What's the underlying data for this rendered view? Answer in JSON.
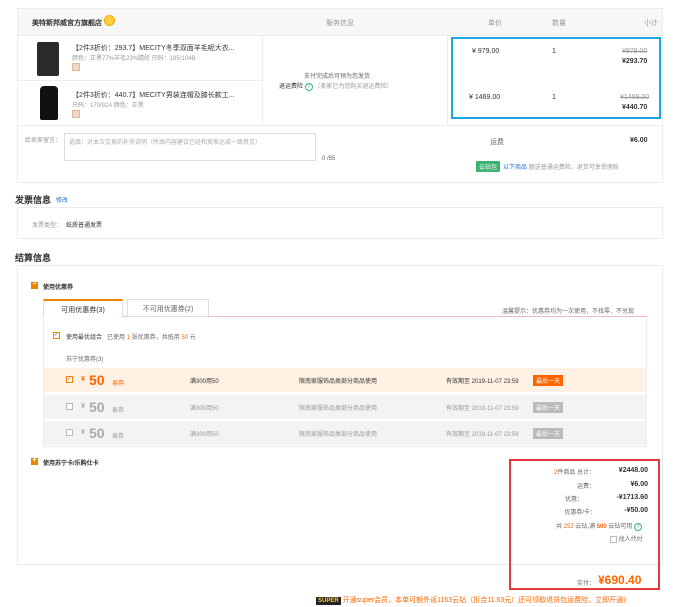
{
  "store": {
    "name": "美特斯邦威官方旗舰店"
  },
  "header_cols": {
    "service": "服务信息",
    "price": "单价",
    "qty": "数量",
    "subtotal": "小计"
  },
  "products": [
    {
      "name": "【2件3折价：293.7】MECITY冬季双面羊毛呢大衣...",
      "meta": "颜色：正黑77%羊毛23%腈纶  尺码：185/104B",
      "price": "¥ 979.00",
      "qty": "1",
      "orig": "¥979.00",
      "final": "¥293.70"
    },
    {
      "name": "【2件3折价：440.7】MECITY男装连帽及膝长款工...",
      "meta": "尺码：170/92A  颜色：正黑",
      "price": "¥ 1469.00",
      "qty": "1",
      "orig": "¥1469.00",
      "final": "¥440.70"
    }
  ],
  "service": {
    "line1": "支付完成后可预为您发货",
    "line2_label": "退运费险",
    "line2_note": "（卖家已为您购买退运费险）"
  },
  "memo": {
    "label": "给卖家留言：",
    "placeholder": "选填：对本次交易的补充说明（所填内容建议已经和卖家达成一致意见）",
    "counter": "0 /85"
  },
  "shipping": {
    "label": "运费",
    "value": "¥6.00",
    "tag": "云钻包",
    "link": "以下商品",
    "desc": "额送普通运费险，退货可享受理赔"
  },
  "invoice": {
    "title": "发票信息",
    "edit": "修改",
    "type_label": "发票类型：",
    "type_value": "纸质普通发票"
  },
  "settle": {
    "title": "结算信息",
    "coupon_section": "使用优惠券",
    "tab_available": "可用优惠券(3)",
    "tab_unavailable": "不可用优惠券(2)",
    "tip": "温馨提示：优惠券均为一次使用，不找零、不兑现",
    "best_combo_pre": "使用最优组合",
    "best_combo_mid1": "已使用",
    "best_combo_n": "1",
    "best_combo_mid2": "张优惠券，共抵用",
    "best_combo_amt": "50",
    "best_combo_unit": "元",
    "group_label": "苏宁优惠券(3)",
    "card_section": "使用苏宁卡/乐购仕卡"
  },
  "coupons": [
    {
      "amount": "50",
      "currency": "¥",
      "kind": "易券",
      "cond": "满300用50",
      "scope": "限南家服饰品类部分商品使用",
      "expire": "有效期至 2019-11-07 23:59",
      "badge": "最后一天",
      "checked": "✓"
    },
    {
      "amount": "50",
      "currency": "¥",
      "kind": "易券",
      "cond": "满300用50",
      "scope": "限南家服饰品类部分商品使用",
      "expire": "有效期至 2019-11-07 23:59",
      "badge": "最后一天",
      "checked": ""
    },
    {
      "amount": "50",
      "currency": "¥",
      "kind": "易券",
      "cond": "满300用50",
      "scope": "限南家服饰品类部分商品使用",
      "expire": "有效期至 2019-11-07 23:59",
      "badge": "最后一天",
      "checked": ""
    }
  ],
  "summary": {
    "count_label_n": "2",
    "count_label": "件商品 总计：",
    "total": "¥2448.00",
    "freight_label": "运费：",
    "freight": "¥6.00",
    "discount_label": "优惠：",
    "discount": "-¥1713.60",
    "coupon_label": "优惠券/卡：",
    "coupon": "-¥50.00",
    "cloud_pre": "共",
    "cloud_n": "252",
    "cloud_mid": "云钻,满",
    "cloud_min": "500",
    "cloud_post": "云钻可用",
    "proxy_pay": "找人代付",
    "pay_label": "实付：",
    "pay_amount": "¥690.40"
  },
  "super_bar": {
    "badge": "SUPER",
    "text": "开通super会员，本单可额外返1163云钻（折合11.63元）还可领取退货包运费险，立即开通》"
  }
}
